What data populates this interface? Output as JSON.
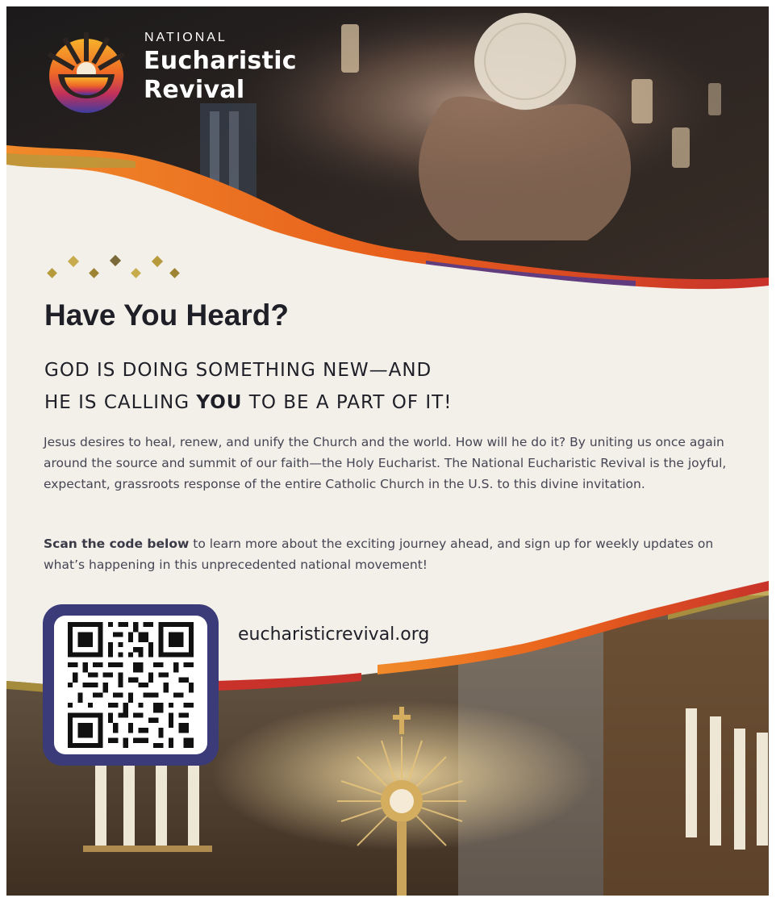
{
  "logo": {
    "small_text": "NATIONAL",
    "line1": "Eucharistic",
    "line2": "Revival"
  },
  "headline": "Have You Heard?",
  "subhead": {
    "line1": "GOD IS DOING SOMETHING NEW—AND",
    "line2_pre": "HE IS CALLING ",
    "line2_bold": "YOU",
    "line2_post": " TO BE A PART OF IT!"
  },
  "body": {
    "para1": "Jesus desires to heal, renew, and unify the Church and the world. How will he do it? By uniting us once again around the source and summit of our faith—the Holy Eucharist. The National Eucharistic Revival is the joyful, expectant, grassroots response of the entire Catholic Church in the U.S. to this divine invitation.",
    "para2_bold": "Scan the code below",
    "para2_rest": " to learn more about the exciting journey ahead, and sign up for weekly updates on what’s happening in this unprecedented national movement!"
  },
  "url": "eucharisticrevival.org",
  "colors": {
    "qr_frame": "#3a3b78",
    "torn_orange": "#e8601c",
    "torn_red": "#c8322a",
    "torn_gold": "#b69a3c",
    "text_dark": "#1f1f28",
    "text_body": "#454553"
  },
  "icons": {
    "logo_mark": "sunburst-chalice-icon",
    "decoration": "diamond-dots-icon",
    "qr": "qr-code-icon"
  }
}
